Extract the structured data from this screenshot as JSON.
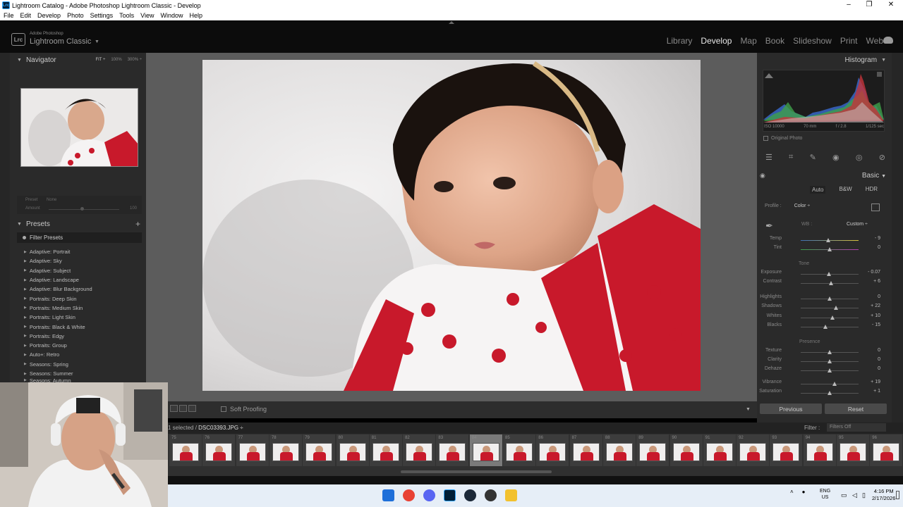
{
  "window": {
    "title": "Lightroom Catalog - Adobe Photoshop Lightroom Classic - Develop",
    "app_icon": "Lrc"
  },
  "menu": [
    "File",
    "Edit",
    "Develop",
    "Photo",
    "Settings",
    "Tools",
    "View",
    "Window",
    "Help"
  ],
  "brand": {
    "logo": "Lrc",
    "line1": "Adobe Photoshop",
    "line2": "Lightroom Classic"
  },
  "modules": [
    {
      "label": "Library",
      "active": false
    },
    {
      "label": "Develop",
      "active": true
    },
    {
      "label": "Map",
      "active": false
    },
    {
      "label": "Book",
      "active": false
    },
    {
      "label": "Slideshow",
      "active": false
    },
    {
      "label": "Print",
      "active": false
    },
    {
      "label": "Web",
      "active": false
    }
  ],
  "navigator": {
    "title": "Navigator",
    "zoom_options": [
      "FIT ÷",
      "100%",
      "300% ÷"
    ]
  },
  "preset_amount": {
    "preset_label": "Preset",
    "preset_value": "None",
    "amount_label": "Amount",
    "amount_value": "100"
  },
  "presets": {
    "title": "Presets",
    "add": "+",
    "filter": "Filter Presets",
    "items": [
      "Adaptive: Portrait",
      "Adaptive: Sky",
      "Adaptive: Subject",
      "Adaptive: Landscape",
      "Adaptive: Blur Background",
      "Portraits: Deep Skin",
      "Portraits: Medium Skin",
      "Portraits: Light Skin",
      "Portraits: Black & White",
      "Portraits: Edgy",
      "Portraits: Group",
      "Auto+: Retro",
      "Seasons: Spring",
      "Seasons: Summer",
      "Seasons: Autumn"
    ]
  },
  "toolbar": {
    "soft_proofing": "Soft Proofing"
  },
  "histogram": {
    "title": "Histogram",
    "iso": "ISO 10000",
    "focal": "70 mm",
    "aperture": "f / 2.8",
    "shutter": "1/125 sec",
    "original_photo": "Original Photo"
  },
  "basic": {
    "title": "Basic",
    "buttons": [
      "Auto",
      "B&W",
      "HDR"
    ],
    "profile_label": "Profile :",
    "profile_value": "Color ÷",
    "wb_label": "WB :",
    "wb_value": "Custom ÷",
    "tone_label": "Tone",
    "presence_label": "Presence",
    "sliders": [
      {
        "name": "Temp",
        "value": "- 9",
        "pos": 0.47
      },
      {
        "name": "Tint",
        "value": "0",
        "pos": 0.5
      },
      {
        "name": "Exposure",
        "value": "- 0.07",
        "pos": 0.49
      },
      {
        "name": "Contrast",
        "value": "+ 6",
        "pos": 0.52
      },
      {
        "name": "Highlights",
        "value": "0",
        "pos": 0.5
      },
      {
        "name": "Shadows",
        "value": "+ 22",
        "pos": 0.61
      },
      {
        "name": "Whites",
        "value": "+ 10",
        "pos": 0.55
      },
      {
        "name": "Blacks",
        "value": "- 15",
        "pos": 0.43
      },
      {
        "name": "Texture",
        "value": "0",
        "pos": 0.5
      },
      {
        "name": "Clarity",
        "value": "0",
        "pos": 0.5
      },
      {
        "name": "Dehaze",
        "value": "0",
        "pos": 0.5
      },
      {
        "name": "Vibrance",
        "value": "+ 19",
        "pos": 0.59
      },
      {
        "name": "Saturation",
        "value": "+ 1",
        "pos": 0.5
      }
    ],
    "previous": "Previous",
    "reset": "Reset"
  },
  "filmstrip": {
    "info_prefix": "1 selected /",
    "filename": "DSC03393.JPG ÷",
    "filter_label": "Filter :",
    "filter_value": "Filters Off",
    "frames": [
      "75",
      "76",
      "77",
      "78",
      "79",
      "80",
      "81",
      "82",
      "83",
      "84",
      "85",
      "86",
      "87",
      "88",
      "89",
      "90",
      "91",
      "92",
      "93",
      "94",
      "95",
      "96"
    ],
    "selected_index": 9
  },
  "taskbar": {
    "lang1": "ENG",
    "lang2": "US",
    "time": "4:16 PM",
    "date": "2/17/2026"
  },
  "colors": {
    "accent": "#e8e8e8",
    "panel": "#2a2a2a",
    "center": "#5c5c5c",
    "red": "#c8192b"
  }
}
